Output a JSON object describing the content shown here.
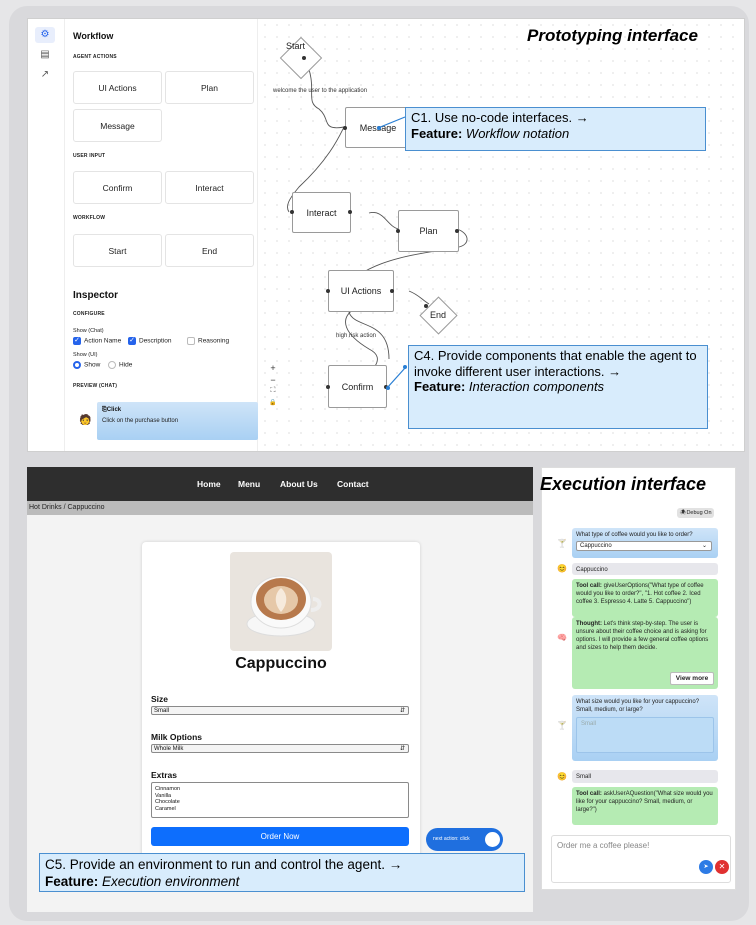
{
  "prototyping": {
    "title": "Prototyping interface",
    "palette": {
      "title": "Workflow",
      "sections": [
        "AGENT ACTIONS",
        "USER INPUT",
        "WORKFLOW"
      ],
      "buttons": [
        "UI Actions",
        "Plan",
        "Message",
        "Confirm",
        "Interact",
        "Start",
        "End"
      ]
    },
    "inspector": {
      "title": "Inspector",
      "configure": "CONFIGURE",
      "show_chat_label": "Show (Chat)",
      "chat_options": [
        {
          "label": "Action Name",
          "checked": true
        },
        {
          "label": "Description",
          "checked": true
        },
        {
          "label": "Reasoning",
          "checked": false
        }
      ],
      "show_ui_label": "Show (UI)",
      "ui_options": [
        {
          "label": "Show",
          "selected": true
        },
        {
          "label": "Hide",
          "selected": false
        }
      ],
      "preview_label": "PREVIEW (CHAT)",
      "preview_title": "⎘Click",
      "preview_text": "Click on the purchase button"
    },
    "zoom_controls": [
      "+",
      "−",
      "⛶",
      "🔒"
    ],
    "nodes": {
      "start": "Start",
      "message": "Message",
      "interact": "Interact",
      "plan": "Plan",
      "ui_actions": "UI Actions",
      "end": "End",
      "confirm": "Confirm"
    },
    "edge_labels": {
      "welcome": "welcome the user to the application",
      "risk": "high risk action"
    },
    "callouts": {
      "c1_text": "C1. Use no-code interfaces. →",
      "c1_feature": "Feature:",
      "c1_feature_value": "Workflow notation",
      "c4_text": "C4. Provide components that enable the agent to invoke different user interactions. →",
      "c4_feature": "Feature:",
      "c4_feature_value": "Interaction components"
    }
  },
  "execution": {
    "title": "Execution interface",
    "nav": [
      "Home",
      "Menu",
      "About Us",
      "Contact"
    ],
    "breadcrumb": "Hot Drinks / Cappuccino",
    "product": "Cappuccino",
    "size_label": "Size",
    "size_value": "Small",
    "milk_label": "Milk Options",
    "milk_value": "Whole Milk",
    "extras_label": "Extras",
    "extras": [
      "Cinnamon",
      "Vanilla",
      "Chocolate",
      "Caramel"
    ],
    "order_button": "Order Now",
    "next_action": "next action: click",
    "callout_c5": "C5. Provide an environment to run and control the agent. →",
    "callout_c5_feature": "Feature:",
    "callout_c5_value": "Execution environment"
  },
  "chat": {
    "debug": "🕷Debug On",
    "q1": "What type of coffee would you like to order?",
    "q1_select": "Cappuccino",
    "user1": "Cappuccino",
    "tool1_label": "Tool call:",
    "tool1_text": "giveUserOptions(\"What type of coffee would you like to order?\", \"1. Hot coffee 2. Iced coffee 3. Espresso 4. Latte 5. Cappuccino\")",
    "thought_label": "Thought:",
    "thought_text": "Let's think step-by-step. The user is unsure about their coffee choice and is asking for options. I will provide a few general coffee options and sizes to help them decide.",
    "view_more": "View more",
    "q2": "What size would you like for your cappuccino? Small, medium, or large?",
    "q2_placeholder": "Small",
    "user2": "Small",
    "tool2_label": "Tool call:",
    "tool2_text": "askUserAQuestion(\"What size would you like for your cappuccino? Small, medium, or large?\")",
    "input_placeholder": "Order me a coffee please!"
  },
  "colors": {
    "accent": "#2563eb",
    "callout": "#d8ecfc",
    "order_button": "#0d6efd",
    "stop": "#e03131"
  }
}
